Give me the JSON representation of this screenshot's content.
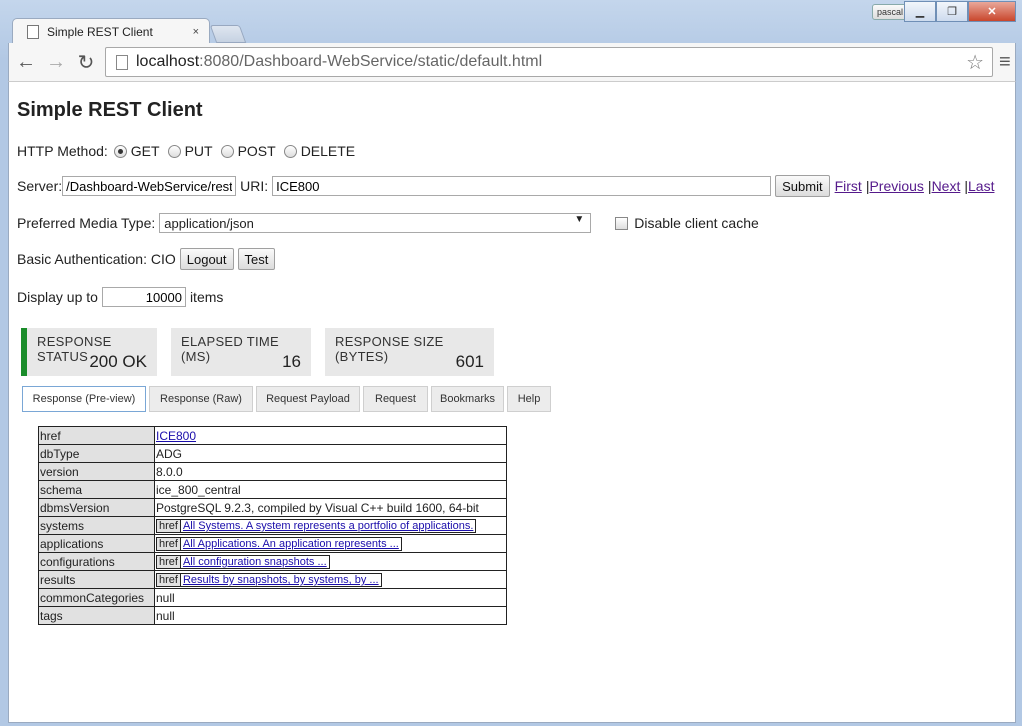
{
  "browser": {
    "tab_title": "Simple REST Client",
    "tab_close": "×",
    "profile_name": "pascal",
    "url_host": "localhost",
    "url_path": ":8080/Dashboard-WebService/static/default.html"
  },
  "page": {
    "title": "Simple REST Client",
    "http_method_label": "HTTP Method:",
    "methods": [
      "GET",
      "PUT",
      "POST",
      "DELETE"
    ],
    "selected_method": "GET",
    "server_label": "Server:",
    "server_value": "/Dashboard-WebService/rest/",
    "uri_label": "URI:",
    "uri_value": "ICE800",
    "submit_label": "Submit",
    "nav_links": {
      "first": "First",
      "previous": "Previous",
      "next": "Next",
      "last": "Last",
      "sep": "|"
    },
    "media_type_label": "Preferred Media Type:",
    "media_type_value": "application/json",
    "disable_cache_label": "Disable client cache",
    "basic_auth_label": "Basic Authentication: CIO",
    "logout_label": "Logout",
    "test_label": "Test",
    "display_up_to_label": "Display up to",
    "display_up_to_value": "10000",
    "items_label": "items"
  },
  "stats": {
    "response_status_label": "RESPONSE STATUS",
    "response_status_value": "200 OK",
    "elapsed_label": "ELAPSED TIME (MS)",
    "elapsed_value": "16",
    "size_label": "RESPONSE SIZE (BYTES)",
    "size_value": "601",
    "status_color": "#1a8c2a"
  },
  "tabs": [
    "Response (Pre-view)",
    "Response (Raw)",
    "Request Payload",
    "Request",
    "Bookmarks",
    "Help"
  ],
  "active_tab": "Response (Pre-view)",
  "response": {
    "href_key": "href",
    "href_value": "ICE800",
    "dbType_key": "dbType",
    "dbType_value": "ADG",
    "version_key": "version",
    "version_value": "8.0.0",
    "schema_key": "schema",
    "schema_value": "ice_800_central",
    "dbmsVersion_key": "dbmsVersion",
    "dbmsVersion_value": "PostgreSQL 9.2.3, compiled by Visual C++ build 1600, 64-bit",
    "systems_key": "systems",
    "systems_value": "All Systems. A system represents a portfolio of applications.",
    "applications_key": "applications",
    "applications_value": "All Applications. An application represents ...",
    "configurations_key": "configurations",
    "configurations_value": "All configuration snapshots ...",
    "results_key": "results",
    "results_value": "Results by snapshots, by systems, by ...",
    "commonCategories_key": "commonCategories",
    "commonCategories_value": "null",
    "tags_key": "tags",
    "tags_value": "null",
    "inner_href_key": "href"
  }
}
